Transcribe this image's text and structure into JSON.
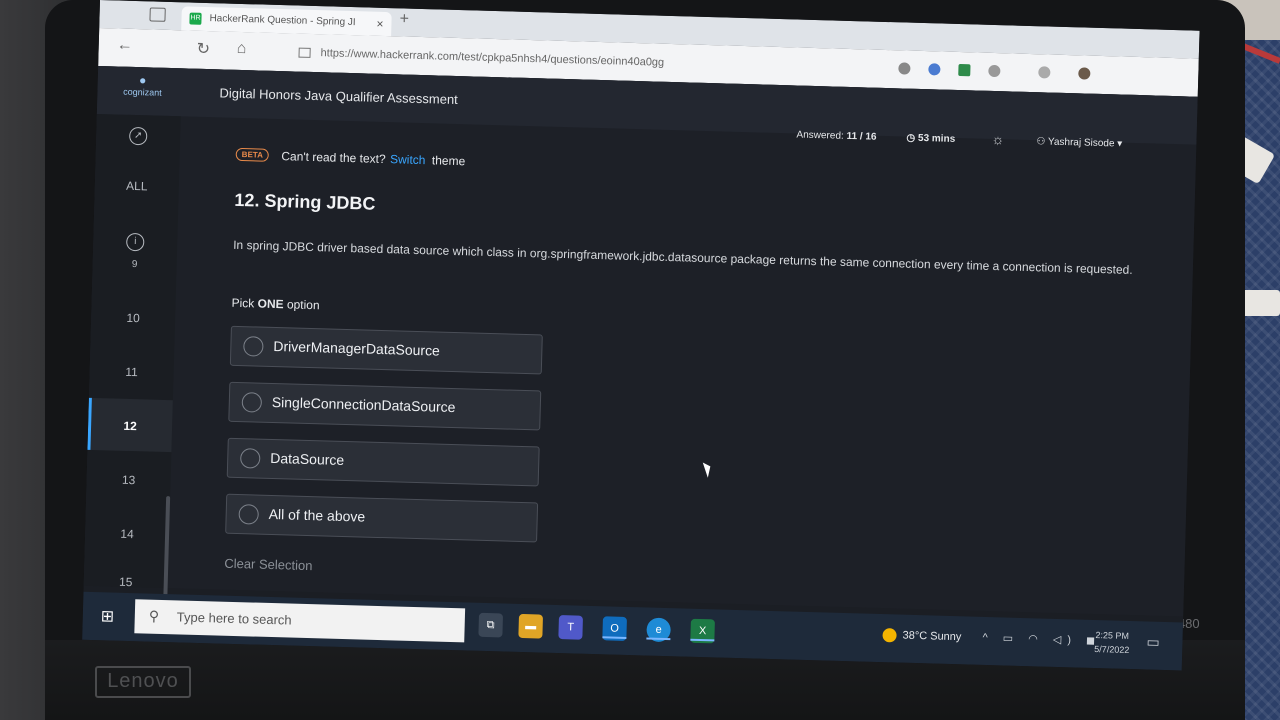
{
  "browser": {
    "tab_title": "HackerRank Question - Spring JI",
    "tab_favicon": "HR",
    "url": "https://www.hackerrank.com/test/cpkpa5nhsh4/questions/eoinn40a0gg"
  },
  "header": {
    "logo_text": "cognizant",
    "title": "Digital Honors Java Qualifier Assessment",
    "answered_label": "Answered:",
    "answered_value": "11 / 16",
    "timer": "53 mins",
    "user_name": "Yashraj Sisode"
  },
  "sidebar": {
    "all_label": "ALL",
    "items": [
      "9",
      "10",
      "11",
      "12",
      "13",
      "14",
      "15"
    ]
  },
  "notice": {
    "badge": "BETA",
    "text": "Can't read the text?",
    "link": "Switch",
    "suffix": "theme"
  },
  "question": {
    "title": "12. Spring JDBC",
    "text": "In spring JDBC driver based data source which class in org.springframework.jdbc.datasource package returns the same connection every time a connection is requested.",
    "pick_prefix": "Pick",
    "pick_bold": "ONE",
    "pick_suffix": "option",
    "options": [
      "DriverManagerDataSource",
      "SingleConnectionDataSource",
      "DataSource",
      "All of the above"
    ],
    "clear_label": "Clear Selection"
  },
  "taskbar": {
    "search_placeholder": "Type here to search",
    "weather": "38°C  Sunny",
    "time": "2:25 PM",
    "date": "5/7/2022"
  },
  "hardware": {
    "brand": "Lenovo",
    "model": "T480"
  },
  "colors": {
    "accent": "#39a6ff",
    "beta": "#e88a4a",
    "page_bg": "#1d2027"
  }
}
